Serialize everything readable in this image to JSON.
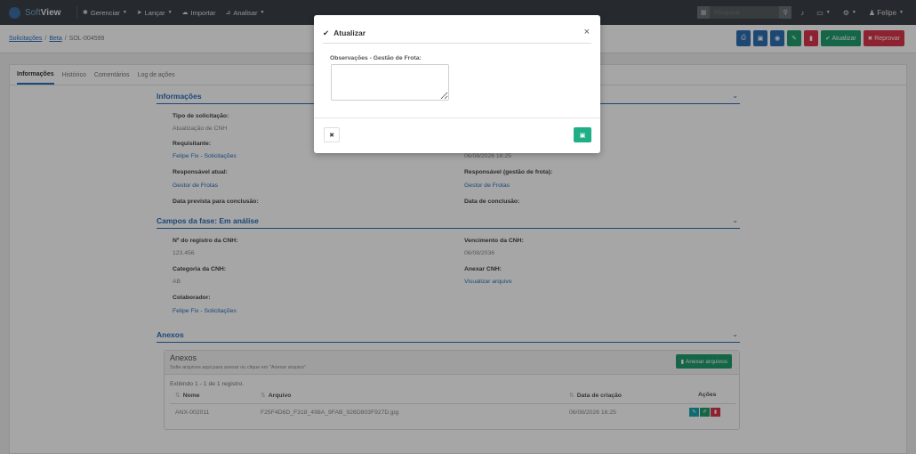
{
  "app": {
    "logo_prefix": "Soft",
    "logo_suffix": "View"
  },
  "nav": [
    {
      "icon": "gear-icon",
      "glyph": "✱",
      "label": "Gerenciar"
    },
    {
      "icon": "send-icon",
      "glyph": "➤",
      "label": "Lançar"
    },
    {
      "icon": "cloud-upload-icon",
      "glyph": "☁",
      "label": "Importar"
    },
    {
      "icon": "chart-icon",
      "glyph": "⊿",
      "label": "Analisar"
    }
  ],
  "topbar": {
    "search_placeholder": "Pesquisar",
    "user_name": "Felipe"
  },
  "breadcrumb": {
    "item1": "Solicitações",
    "item2": "Beta",
    "current": "SOL-004599"
  },
  "actions": {
    "approve_label": "Atualizar",
    "reject_label": "Reprovar"
  },
  "tabs": [
    "Informações",
    "Histórico",
    "Comentários",
    "Log de ações"
  ],
  "sections": {
    "info": "Informações",
    "phase": "Campos da fase: Em análise",
    "attachments": "Anexos"
  },
  "info": {
    "tipo_label": "Tipo de solicitação:",
    "tipo_value": "Atualização de CNH",
    "req_label": "Requisitante:",
    "req_value": "Felipe Fix - Solicitações",
    "req_date_value": "06/08/2026 16:25",
    "resp_label": "Responsável atual:",
    "resp_value": "Gestor de Frotas",
    "resp_frota_label": "Responsável (gestão de frota):",
    "resp_frota_value": "Gestor de Frotas",
    "prevista_label": "Data prevista para conclusão:",
    "conclusao_label": "Data de conclusão:"
  },
  "phase": {
    "registro_label": "Nº do registro da CNH:",
    "registro_value": "123.456",
    "venc_label": "Vencimento da CNH:",
    "venc_value": "06/08/2036",
    "cat_label": "Categoria da CNH:",
    "cat_value": "AB",
    "anexar_label": "Anexar CNH:",
    "anexar_value": "Visualizar arquivo",
    "colab_label": "Colaborador:",
    "colab_value": "Felipe Fix - Solicitações"
  },
  "attachments": {
    "box_title": "Anexos",
    "box_subtitle": "Solte arquivos aqui para anexar ou clique em \"Anexar arquivo\".",
    "add_button": "Anexar arquivos",
    "count_text": "Exibindo 1 - 1 de 1 registro.",
    "columns": [
      "Nome",
      "Arquivo",
      "Data de criação",
      "Ações"
    ],
    "rows": [
      {
        "name": "ANX-002011",
        "file": "F25F4D6D_F318_498A_9FAB_926D803F927D.jpg",
        "date": "06/08/2026 16:25"
      }
    ]
  },
  "modal": {
    "title": "Atualizar",
    "field_label": "Observações - Gestão de Frota:",
    "field_value": ""
  },
  "colors": {
    "accent": "#2a6ebc",
    "success": "#1f9d6e",
    "danger": "#d9354b",
    "topbar": "#3b4148"
  }
}
